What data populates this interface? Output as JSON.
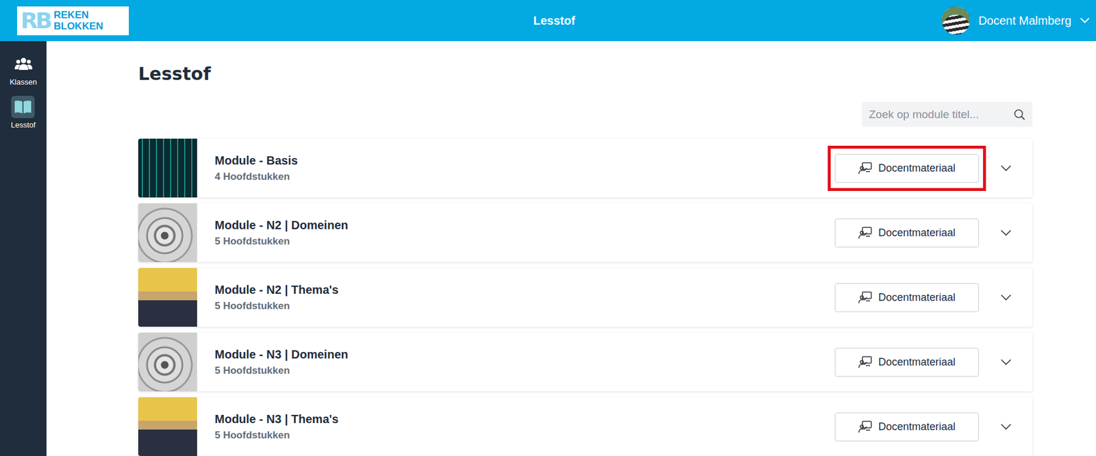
{
  "header": {
    "logo": {
      "mark": "RB",
      "line1": "REKEN",
      "line2": "BLOKKEN"
    },
    "title": "Lesstof",
    "user": {
      "name": "Docent Malmberg"
    }
  },
  "sidebar": {
    "items": [
      {
        "label": "Klassen",
        "kind": "classes",
        "selected": false
      },
      {
        "label": "Lesstof",
        "kind": "content",
        "selected": true
      }
    ]
  },
  "page": {
    "heading": "Lesstof"
  },
  "search": {
    "placeholder": "Zoek op module titel..."
  },
  "modules": [
    {
      "title": "Module - Basis",
      "chapters": "4 Hoofdstukken",
      "button": "Docentmateriaal",
      "highlighted": true,
      "expanded": false,
      "kind": "code"
    },
    {
      "title": "Module - N2 | Domeinen",
      "chapters": "5 Hoofdstukken",
      "button": "Docentmateriaal",
      "highlighted": false,
      "expanded": false,
      "kind": "spiral"
    },
    {
      "title": "Module - N2 | Thema's",
      "chapters": "5 Hoofdstukken",
      "button": "Docentmateriaal",
      "highlighted": false,
      "expanded": false,
      "kind": "classroom"
    },
    {
      "title": "Module - N3 | Domeinen",
      "chapters": "5 Hoofdstukken",
      "button": "Docentmateriaal",
      "highlighted": false,
      "expanded": false,
      "kind": "spiral"
    },
    {
      "title": "Module - N3 | Thema's",
      "chapters": "5 Hoofdstukken",
      "button": "Docentmateriaal",
      "highlighted": false,
      "expanded": false,
      "kind": "classroom"
    }
  ]
}
